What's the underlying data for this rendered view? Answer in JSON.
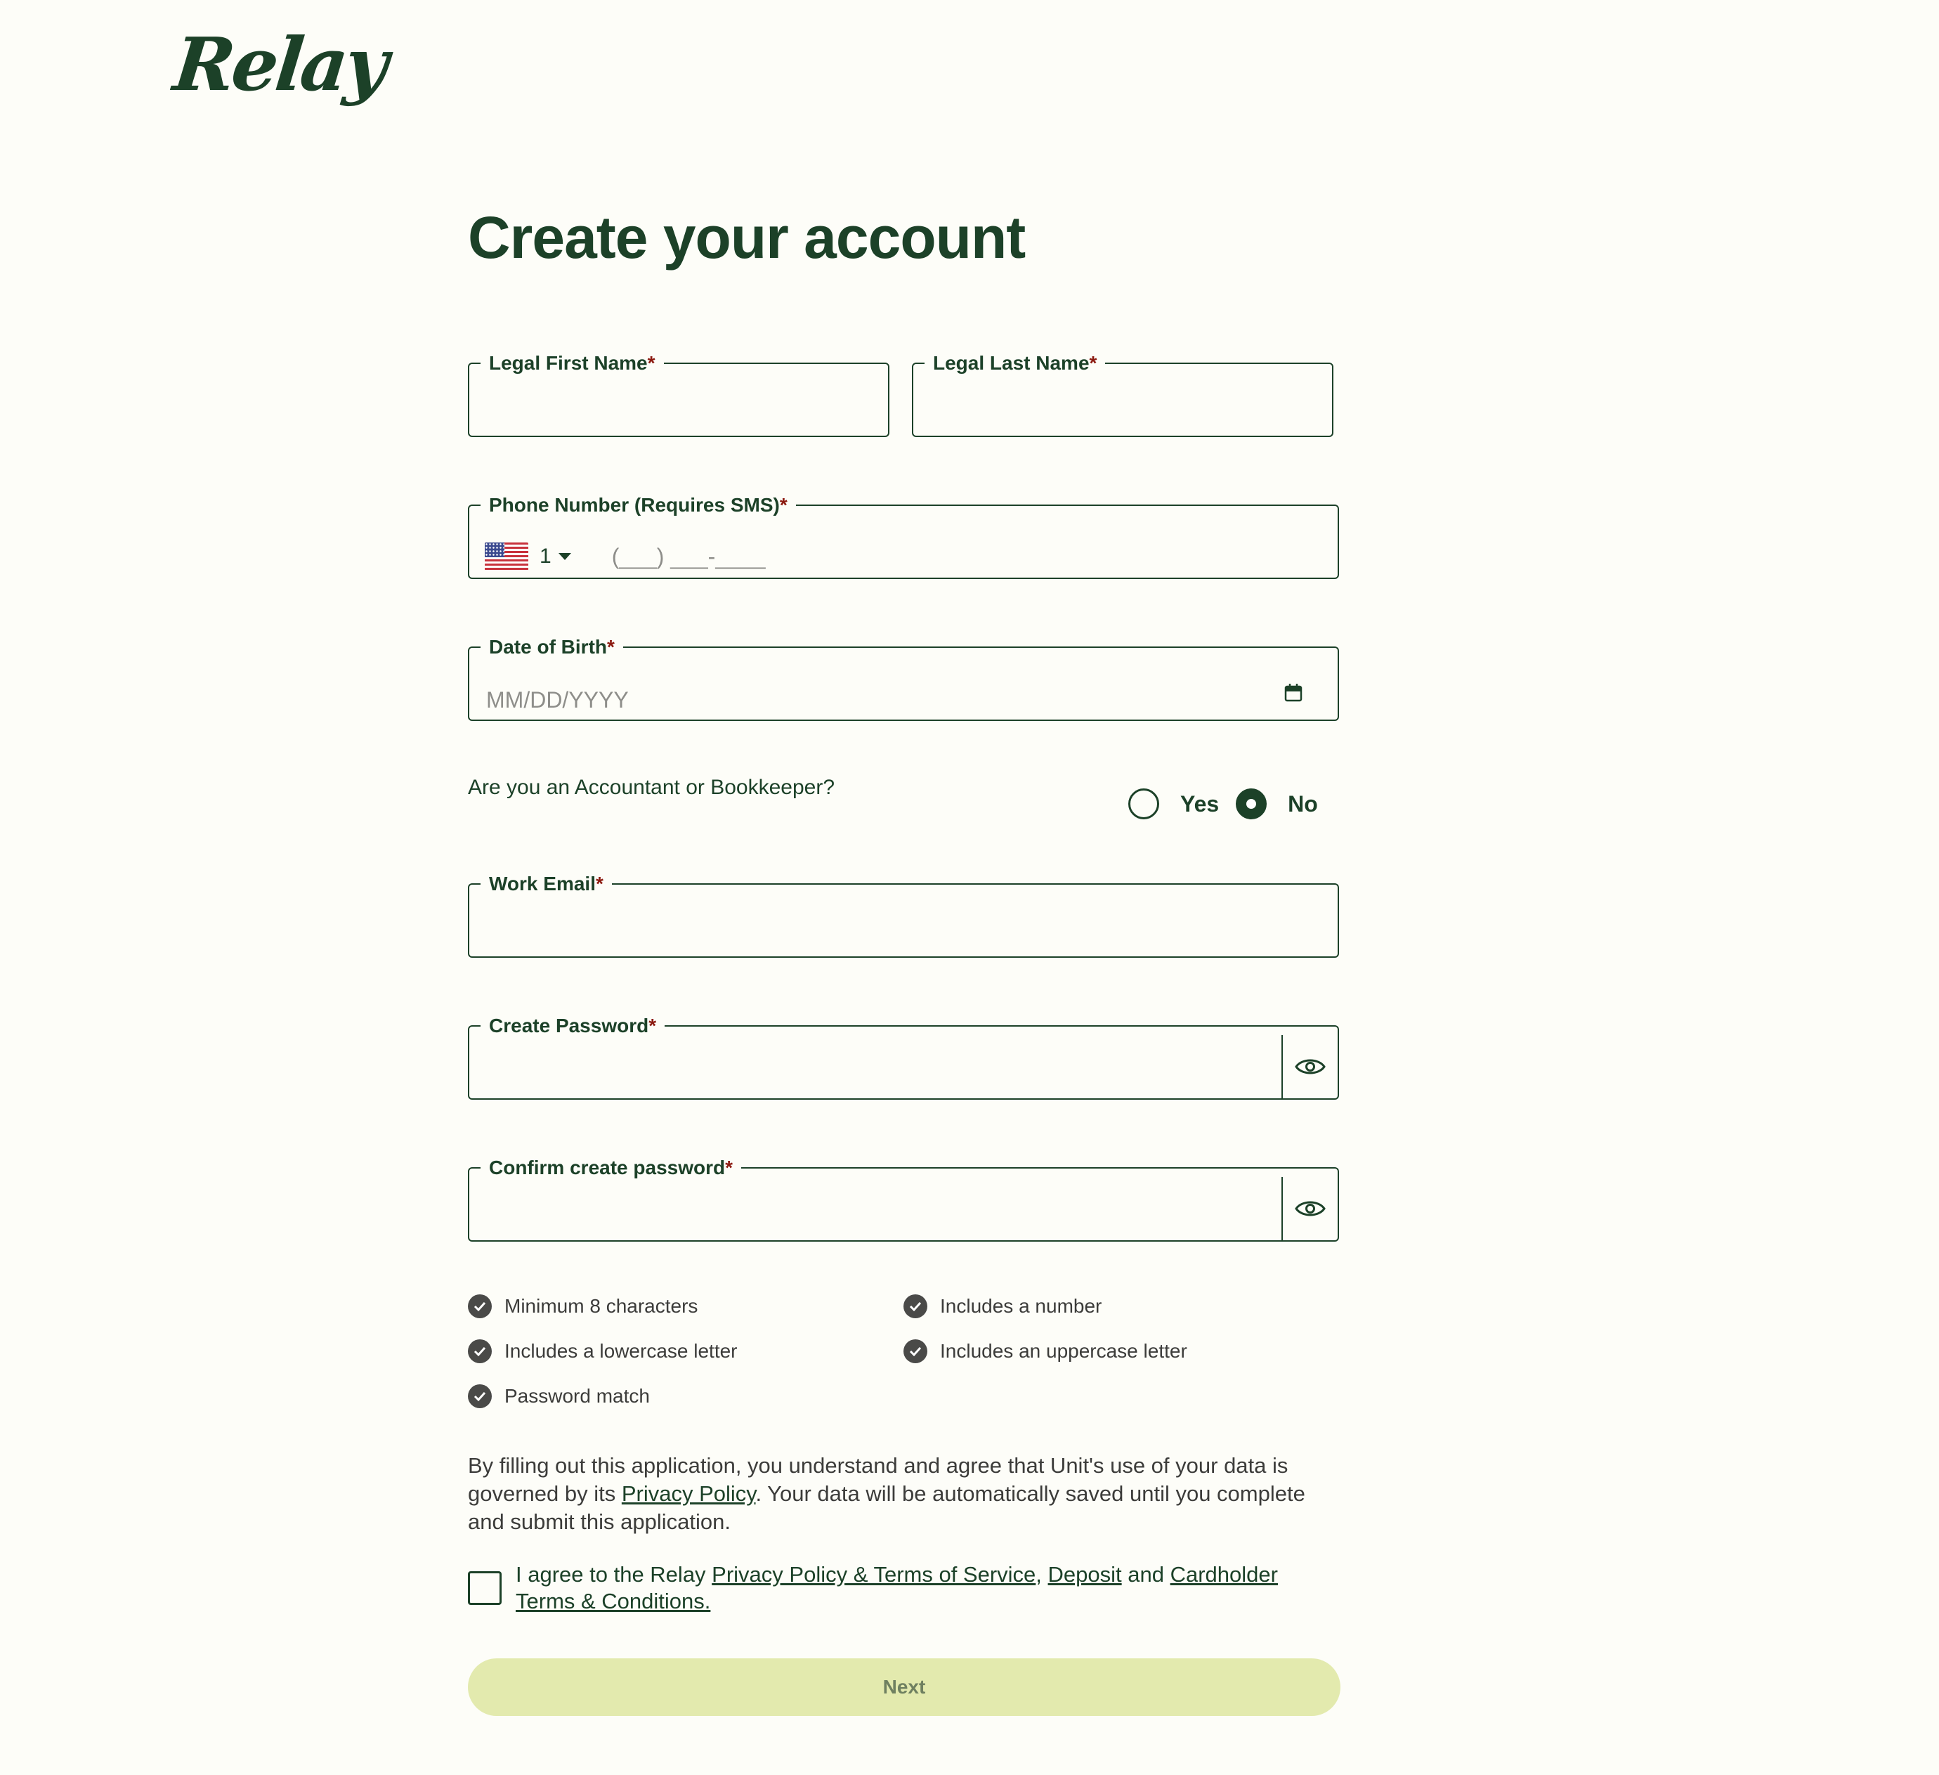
{
  "brand": {
    "logo_text": "Relay"
  },
  "page": {
    "title": "Create your account"
  },
  "form": {
    "required_marker": "*",
    "first_name": {
      "label": "Legal First Name",
      "value": ""
    },
    "last_name": {
      "label": "Legal Last Name",
      "value": ""
    },
    "phone": {
      "label": "Phone Number (Requires SMS)",
      "country_flag": "us-flag-icon",
      "country_code": "1",
      "placeholder": "(___) ___-____"
    },
    "dob": {
      "label": "Date of Birth",
      "placeholder": "MM/DD/YYYY",
      "icon": "calendar-icon"
    },
    "accountant_question": {
      "text": "Are you an Accountant or Bookkeeper?",
      "options": [
        "Yes",
        "No"
      ],
      "selected": "No"
    },
    "work_email": {
      "label": "Work Email",
      "value": ""
    },
    "password": {
      "label": "Create Password",
      "value": "",
      "icon": "eye-icon"
    },
    "confirm_password": {
      "label": "Confirm create password",
      "value": "",
      "icon": "eye-icon"
    }
  },
  "password_rules": [
    "Minimum 8 characters",
    "Includes a number",
    "Includes a lowercase letter",
    "Includes an uppercase letter",
    "Password match"
  ],
  "disclaimer": {
    "part1": "By filling out this application, you understand and agree that Unit's use of your data is governed by its ",
    "link": "Privacy Policy",
    "part2": ". Your data will be automatically saved until you complete and submit this application."
  },
  "agreement": {
    "checked": false,
    "prefix": "I agree to the Relay ",
    "link1": "Privacy Policy & Terms of Service",
    "sep1": ", ",
    "link2": "Deposit",
    "sep2": " and ",
    "link3": "Cardholder Terms & Conditions."
  },
  "next_button": {
    "label": "Next"
  },
  "colors": {
    "background": "#FDFDF8",
    "primary": "#1C4128",
    "required": "#8C1A10",
    "button_disabled_bg": "#E3EAAE",
    "button_disabled_text": "#6F8060",
    "check_icon_bg": "#4A4A48"
  }
}
